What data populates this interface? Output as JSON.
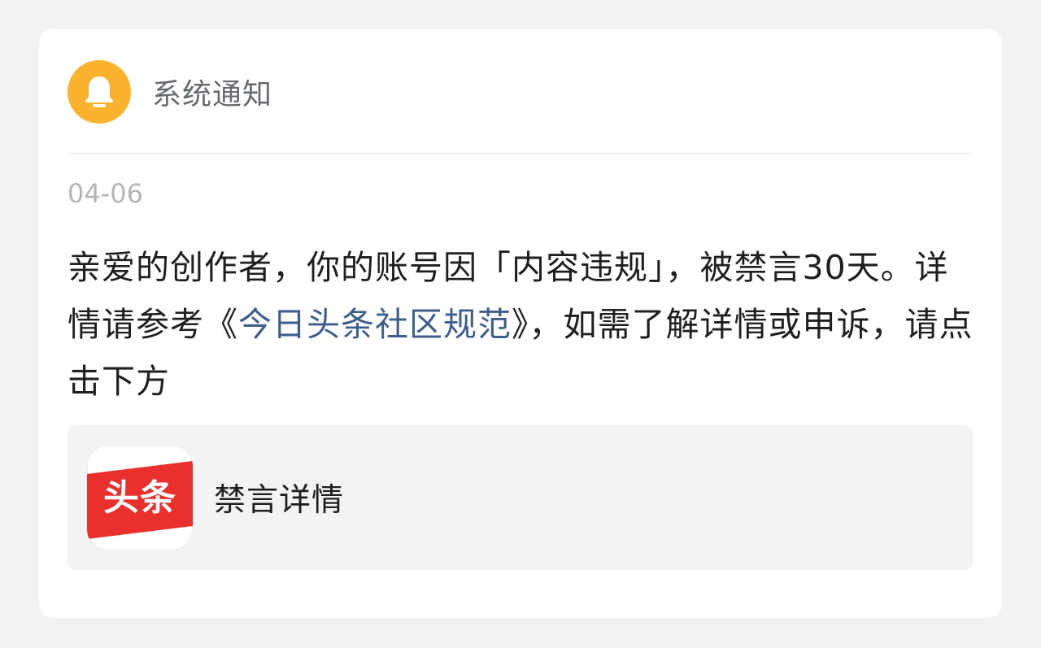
{
  "notification": {
    "title": "系统通知",
    "icon": "bell-icon",
    "icon_color": "#fbb32d",
    "date": "04-06",
    "message": {
      "before_link": "亲爱的创作者，你的账号因「内容违规」，被禁言30天。详情请参考《",
      "link": "今日头条社区规范",
      "after_link": "》，如需了解详情或申诉，请点击下方"
    }
  },
  "action_card": {
    "app_logo_text": "头条",
    "app_logo_color": "#e9302d",
    "label": "禁言详情"
  }
}
